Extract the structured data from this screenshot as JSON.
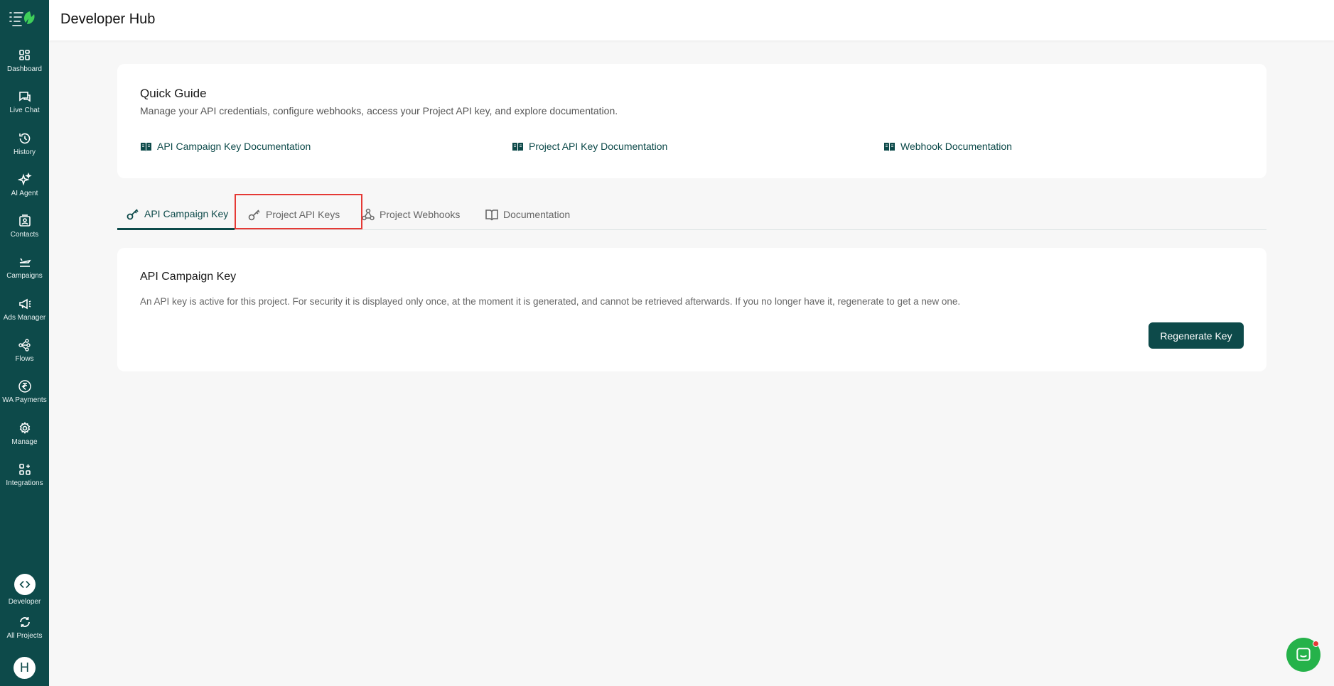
{
  "colors": {
    "brand": "#0d4a4a",
    "accent_red": "#e53935",
    "chat_green": "#25b24a"
  },
  "sidebar": {
    "items": [
      {
        "label": "Dashboard",
        "icon": "dashboard-icon"
      },
      {
        "label": "Live Chat",
        "icon": "chat-icon"
      },
      {
        "label": "History",
        "icon": "history-icon"
      },
      {
        "label": "AI Agent",
        "icon": "sparkle-icon"
      },
      {
        "label": "Contacts",
        "icon": "contacts-icon"
      },
      {
        "label": "Campaigns",
        "icon": "plane-icon"
      },
      {
        "label": "Ads Manager",
        "icon": "megaphone-icon"
      },
      {
        "label": "Flows",
        "icon": "flows-icon"
      },
      {
        "label": "WA Payments",
        "icon": "rupee-icon"
      },
      {
        "label": "Manage",
        "icon": "gear-icon"
      },
      {
        "label": "Integrations",
        "icon": "integrations-icon"
      }
    ],
    "developer_label": "Developer",
    "all_projects_label": "All Projects",
    "avatar_initial": "H"
  },
  "header": {
    "title": "Developer Hub"
  },
  "guide": {
    "title": "Quick Guide",
    "subtitle": "Manage your API credentials, configure webhooks, access your Project API key, and explore documentation.",
    "links": [
      "API Campaign Key Documentation",
      "Project API Key Documentation",
      "Webhook Documentation"
    ]
  },
  "tabs": [
    {
      "label": "API Campaign Key",
      "active": true
    },
    {
      "label": "Project API Keys",
      "active": false
    },
    {
      "label": "Project Webhooks",
      "active": false
    },
    {
      "label": "Documentation",
      "active": false
    }
  ],
  "key_card": {
    "title": "API Campaign Key",
    "description": "An API key is active for this project. For security it is displayed only once, at the moment it is generated, and cannot be retrieved afterwards. If you no longer have it, regenerate to get a new one.",
    "button_label": "Regenerate Key"
  }
}
